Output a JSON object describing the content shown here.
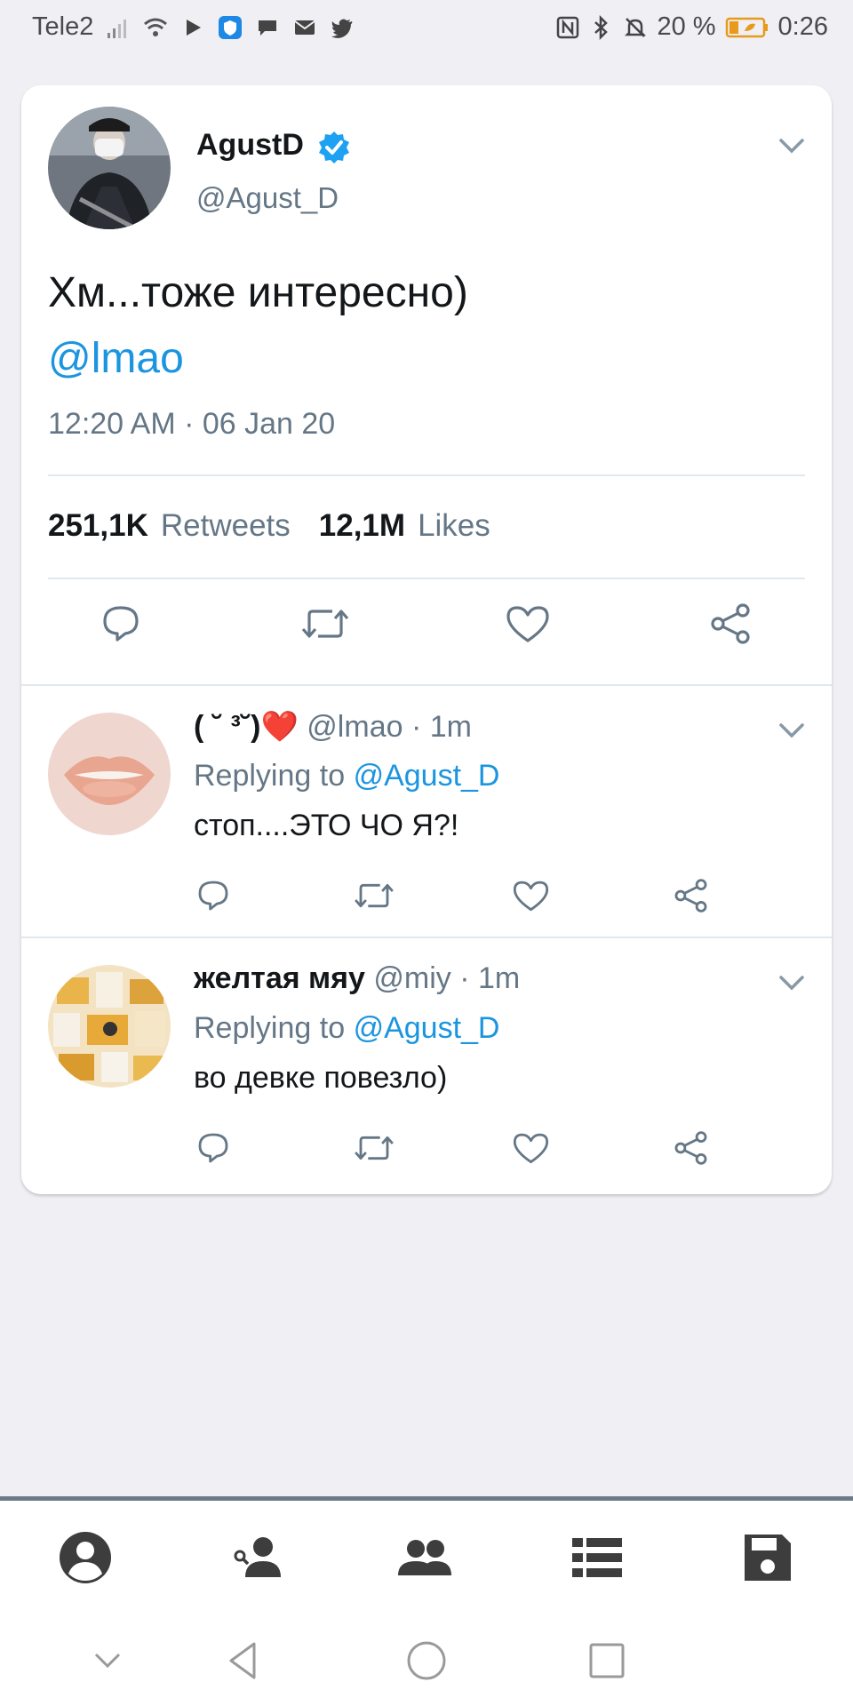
{
  "status_bar": {
    "carrier": "Tele2",
    "battery_percent": "20 %",
    "time": "0:26",
    "icons": [
      "signal-icon",
      "wifi-icon",
      "play-icon",
      "shield-app-icon",
      "chat-icon",
      "mail-icon",
      "twitter-icon",
      "nfc-icon",
      "bluetooth-icon",
      "mute-icon",
      "battery-icon"
    ]
  },
  "main_tweet": {
    "author_name": "AgustD",
    "author_handle": "@Agust_D",
    "text": "Хм...тоже интересно)",
    "mention": "@lmao",
    "timestamp": "12:20 AM · 06 Jan 20",
    "retweets_count": "251,1K",
    "retweets_label": "Retweets",
    "likes_count": "12,1M",
    "likes_label": "Likes"
  },
  "replies": [
    {
      "name": "( ˘ ³˘)❤️",
      "meta": "@lmao · 1m",
      "replying_prefix": "Replying to",
      "replying_to": "@Agust_D",
      "text": "стоп....ЭТО ЧО Я?!"
    },
    {
      "name": "желтая мяу",
      "meta": "@miy · 1m",
      "replying_prefix": "Replying to",
      "replying_to": "@Agust_D",
      "text": "во девке повезло)"
    }
  ],
  "colors": {
    "link": "#1b95e0",
    "secondary_text": "#657786",
    "background": "#efeff4",
    "verified": "#1da1f2",
    "nav_icon": "#4a4a4a"
  },
  "bottom_nav": [
    "profile-icon",
    "find-people-icon",
    "group-icon",
    "list-icon",
    "save-icon"
  ],
  "system_nav": [
    "hide-keyboard-icon",
    "back-icon",
    "home-icon",
    "recents-icon"
  ]
}
